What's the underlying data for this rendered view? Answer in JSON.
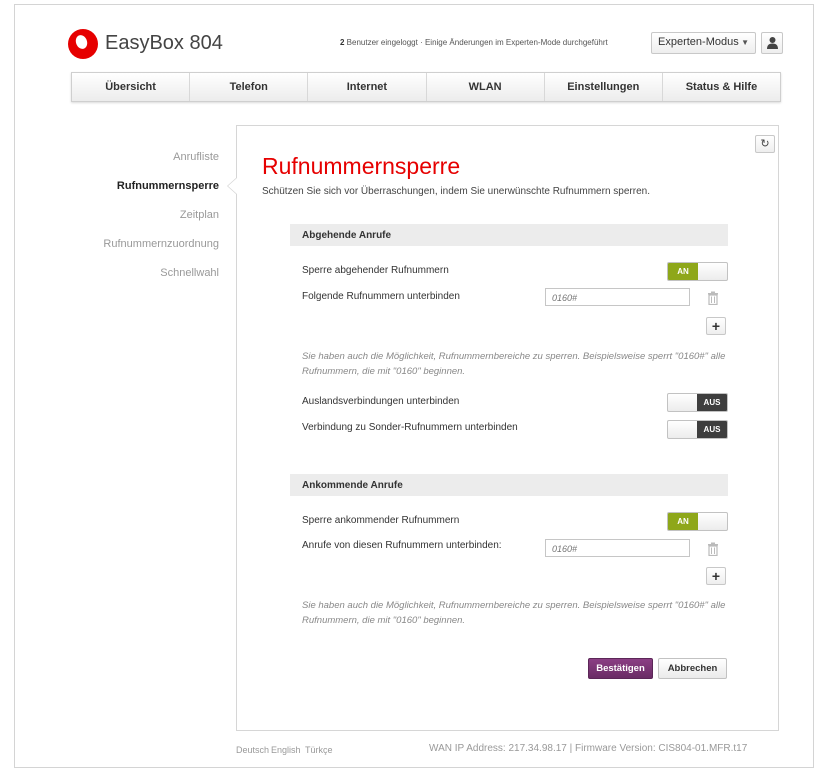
{
  "header": {
    "brand": "EasyBox 804",
    "status_count": "2",
    "status_text": " Benutzer eingeloggt · Einige Änderungen im Experten-Mode durchgeführt",
    "mode_select": "Experten-Modus",
    "icons": {
      "logo": "vodafone-logo",
      "user": "user-icon",
      "caret": "chevron-down-icon"
    }
  },
  "nav": {
    "tabs": [
      {
        "label": "Übersicht"
      },
      {
        "label": "Telefon"
      },
      {
        "label": "Internet"
      },
      {
        "label": "WLAN"
      },
      {
        "label": "Einstellungen"
      },
      {
        "label": "Status & Hilfe"
      }
    ]
  },
  "sidebar": {
    "items": [
      {
        "label": "Anrufliste",
        "active": false
      },
      {
        "label": "Rufnummernsperre",
        "active": true
      },
      {
        "label": "Zeitplan",
        "active": false
      },
      {
        "label": "Rufnummernzuordnung",
        "active": false
      },
      {
        "label": "Schnellwahl",
        "active": false
      }
    ]
  },
  "main": {
    "title": "Rufnummernsperre",
    "subtitle": "Schützen Sie sich vor Überraschungen, indem Sie unerwünschte Rufnummern sperren.",
    "refresh_icon": "refresh-icon",
    "outgoing": {
      "heading": "Abgehende Anrufe",
      "block_label": "Sperre abgehender Rufnummern",
      "block_state": "AN",
      "numbers_label": "Folgende Rufnummern unterbinden",
      "numbers_placeholder": "0160#",
      "note": "Sie haben auch die Möglichkeit, Rufnummernbereiche zu sperren. Beispielsweise sperrt \"0160#\" alle Rufnummern, die mit \"0160\" beginnen.",
      "international_label": "Auslandsverbindungen unterbinden",
      "international_state": "AUS",
      "premium_label": "Verbindung zu Sonder-Rufnummern unterbinden",
      "premium_state": "AUS"
    },
    "incoming": {
      "heading": "Ankommende Anrufe",
      "block_label": "Sperre ankommender Rufnummern",
      "block_state": "AN",
      "numbers_label": "Anrufe von diesen Rufnummern unterbinden:",
      "numbers_placeholder": "0160#",
      "note": "Sie haben auch die Möglichkeit, Rufnummernbereiche zu sperren. Beispielsweise sperrt \"0160#\" alle Rufnummern, die mit \"0160\" beginnen."
    },
    "buttons": {
      "confirm": "Bestätigen",
      "cancel": "Abbrechen",
      "plus": "+"
    }
  },
  "footer": {
    "languages": [
      "Deutsch",
      "English",
      "Türkçe"
    ],
    "info": "WAN IP Address: 217.34.98.17 | Firmware Version: CIS804-01.MFR.t17"
  },
  "colors": {
    "accent": "#e60000",
    "toggle_on": "#8ea71a",
    "toggle_off": "#3e3e3e",
    "confirm": "#7a3574"
  }
}
